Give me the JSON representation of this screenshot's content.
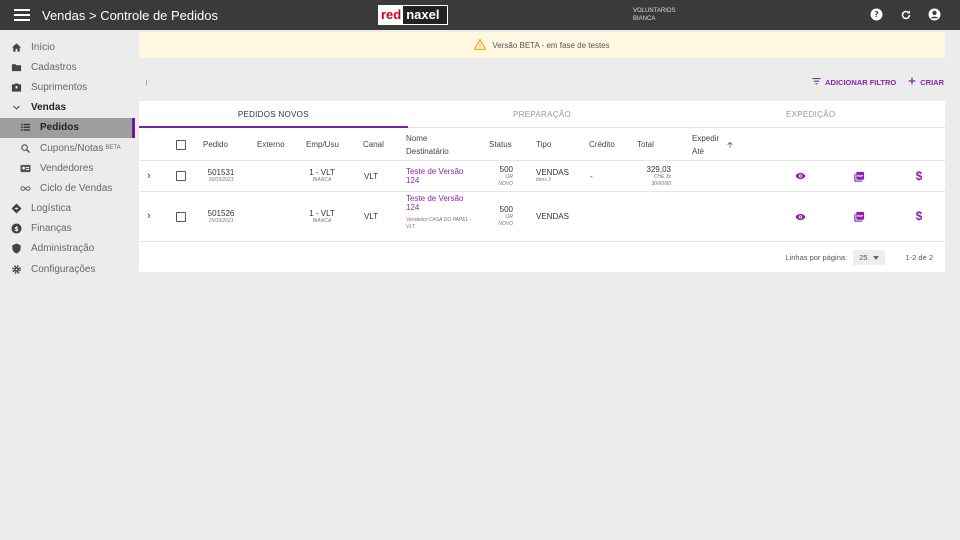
{
  "header": {
    "title": "Vendas > Controle de Pedidos",
    "logo_left": "red",
    "logo_right": "naxel",
    "org_line1": "VOLUNTARIOS",
    "org_line2": "BIANCA"
  },
  "sidebar": {
    "items": [
      {
        "label": "Início",
        "icon": "home-icon"
      },
      {
        "label": "Cadastros",
        "icon": "folder-icon"
      },
      {
        "label": "Suprimentos",
        "icon": "box-icon"
      },
      {
        "label": "Vendas",
        "icon": "chevron-down-icon"
      },
      {
        "label": "Pedidos",
        "icon": "list-icon"
      },
      {
        "label": "Cupons/Notas",
        "badge": "BETA",
        "icon": "receipt-search-icon"
      },
      {
        "label": "Vendedores",
        "icon": "id-card-icon"
      },
      {
        "label": "Ciclo de Vendas",
        "icon": "infinity-icon"
      },
      {
        "label": "Logística",
        "icon": "diamond-icon"
      },
      {
        "label": "Finanças",
        "icon": "dollar-circle-icon"
      },
      {
        "label": "Administração",
        "icon": "shield-icon"
      },
      {
        "label": "Configurações",
        "icon": "gear-icon"
      }
    ]
  },
  "banner": {
    "text": "Versão BETA - em fase de testes"
  },
  "toolbar": {
    "filter_label": "ADICIONAR FILTRO",
    "create_label": "CRIAR"
  },
  "tabs": [
    "PEDIDOS NOVOS",
    "PREPARAÇÃO",
    "EXPEDIÇÃO"
  ],
  "table": {
    "headers": {
      "pedido": "Pedido",
      "externo": "Externo",
      "emp": "Emp/Usu",
      "canal": "Canal",
      "nome1": "Nome",
      "nome2": "Destinatário",
      "status": "Status",
      "tipo": "Tipo",
      "credito": "Crédito",
      "total": "Total",
      "expedir1": "Expedir",
      "expedir2": "Até"
    },
    "rows": [
      {
        "pedido": "501531",
        "data": "16/03/2021",
        "emp": "1 - VLT",
        "usu": "BIANCA",
        "canal": "VLT",
        "nome": "Teste de Versão 124",
        "sub": "",
        "status": "500",
        "status_sub1": "OR",
        "status_sub2": "NOVO",
        "tipo": "VENDAS",
        "tipo_sub": "Itens 2",
        "credito": "-",
        "total": "329,03",
        "total_sub1": "CHE 3x",
        "total_sub2": "30/60/90"
      },
      {
        "pedido": "501526",
        "data": "15/03/2021",
        "emp": "1 - VLT",
        "usu": "BIANCA",
        "canal": "VLT",
        "nome": "Teste de Versão 124",
        "sub": "Vendedor:CASA DO PAPEL - VLT",
        "status": "500",
        "status_sub1": "OR",
        "status_sub2": "NOVO",
        "tipo": "VENDAS",
        "tipo_sub": "",
        "credito": "",
        "total": "",
        "total_sub1": "",
        "total_sub2": ""
      }
    ]
  },
  "pagination": {
    "label": "Linhas por página:",
    "per_page": "25",
    "range": "1-2 de 2"
  },
  "colors": {
    "topbar": "#3a3a3a",
    "accent": "#8e24aa",
    "banner": "#fff8e1",
    "active_nav": "#9e9e9e"
  }
}
